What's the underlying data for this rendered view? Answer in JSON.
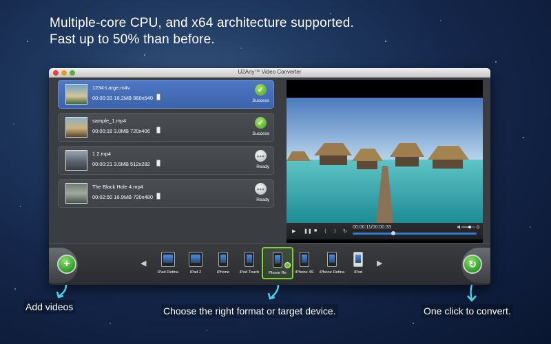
{
  "headline": {
    "line1": "Multiple-core CPU, and x64 architecture supported.",
    "line2": "Fast up to 50% than before."
  },
  "window": {
    "title": "U2Any™ Video Converter"
  },
  "files": [
    {
      "name": "1234-Large.m4v",
      "meta": "00:00:33 16.2MB 960x540",
      "status": "Success",
      "state": "ok"
    },
    {
      "name": "sample_1.mp4",
      "meta": "00:00:18 3.8MB 720x406",
      "status": "Success",
      "state": "ok"
    },
    {
      "name": "1 2.mp4",
      "meta": "00:00:21 3.6MB 512x282",
      "status": "Ready",
      "state": "wait"
    },
    {
      "name": "The Black Hole 4.mp4",
      "meta": "00:02:50 16.9MB 720x480",
      "status": "Ready",
      "state": "wait"
    }
  ],
  "player": {
    "time": "00:00:11/00:00:33",
    "progress": 0.33,
    "volume": 0.6
  },
  "devices": [
    {
      "label": "iPad Retina",
      "kind": "tablet"
    },
    {
      "label": "iPad 2",
      "kind": "tablet"
    },
    {
      "label": "iPhone",
      "kind": "phone"
    },
    {
      "label": "iPod Touch",
      "kind": "phone"
    },
    {
      "label": "Phone Re",
      "kind": "phone",
      "selected": true
    },
    {
      "label": "iPhone 4S",
      "kind": "phone"
    },
    {
      "label": "iPhone Retina",
      "kind": "phone"
    },
    {
      "label": "iPod",
      "kind": "phone"
    }
  ],
  "captions": {
    "add": "Add videos",
    "choose": "Choose the right format or target device.",
    "convert": "One click to convert."
  },
  "colors": {
    "accent_green": "#4ea21d",
    "select_blue": "#3c63ab",
    "progress_blue": "#2f7fd4"
  }
}
